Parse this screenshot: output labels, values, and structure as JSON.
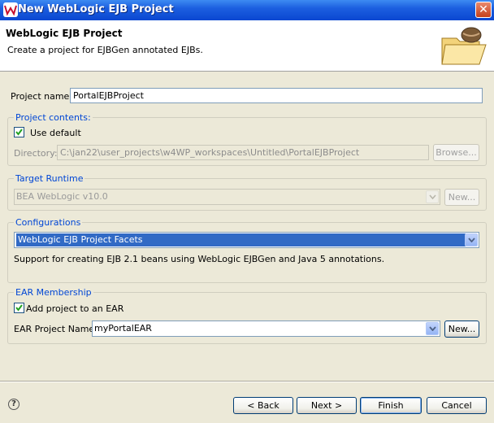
{
  "window": {
    "title": "New WebLogic EJB Project",
    "icon": "weblogic-logo-icon",
    "close_glyph": "✕"
  },
  "banner": {
    "title": "WebLogic EJB Project",
    "description": "Create a project for EJBGen annotated EJBs.",
    "icon": "folder-with-bean-icon"
  },
  "project_name": {
    "label": "Project name:",
    "value": "PortalEJBProject"
  },
  "project_contents": {
    "heading": "Project contents:",
    "use_default_label": "Use default",
    "use_default_checked": true,
    "directory_label": "Directory:",
    "directory_value": "C:\\jan22\\user_projects\\w4WP_workspaces\\Untitled\\PortalEJBProject",
    "browse_label": "Browse..."
  },
  "target_runtime": {
    "heading": "Target Runtime",
    "value": "BEA WebLogic v10.0",
    "new_label": "New..."
  },
  "configurations": {
    "heading": "Configurations",
    "value": "WebLogic EJB Project Facets",
    "description": "Support for creating EJB 2.1 beans using WebLogic EJBGen and Java 5 annotations."
  },
  "ear_membership": {
    "heading": "EAR Membership",
    "add_label": "Add project to an EAR",
    "add_checked": true,
    "ear_name_label": "EAR Project Name:",
    "ear_name_value": "myPortalEAR",
    "new_label": "New..."
  },
  "footer": {
    "help_glyph": "?",
    "back_label": "< Back",
    "next_label": "Next >",
    "finish_label": "Finish",
    "cancel_label": "Cancel"
  },
  "colors": {
    "title_bar": "#0a47d1",
    "selection": "#316ac5",
    "group_heading": "#0046d5"
  }
}
